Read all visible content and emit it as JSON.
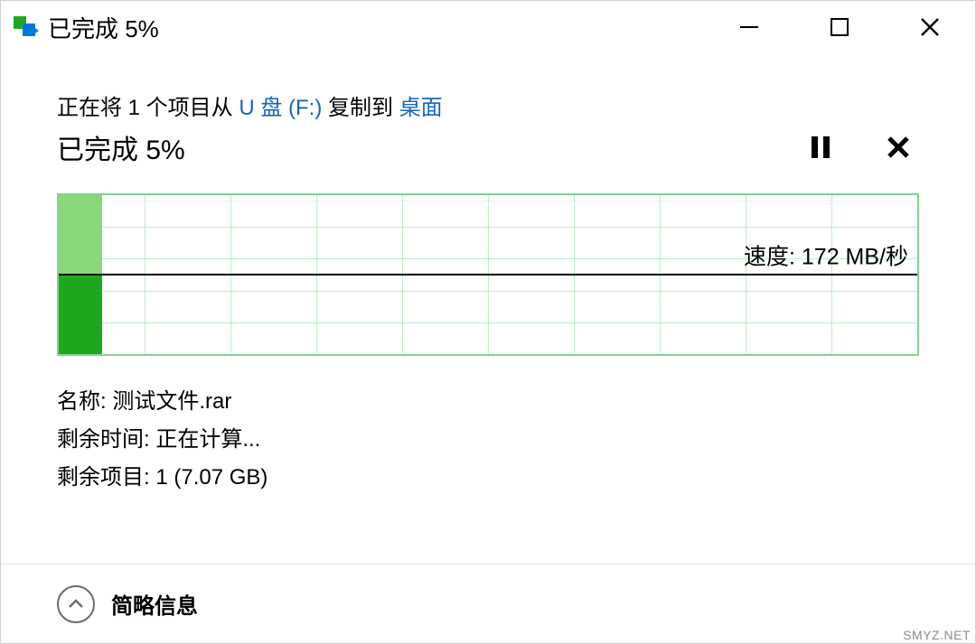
{
  "titlebar": {
    "title": "已完成 5%"
  },
  "copy": {
    "prefix": "正在将 1 个项目从 ",
    "source": "U 盘 (F:)",
    "middle": " 复制到 ",
    "dest": "桌面"
  },
  "progress": {
    "label": "已完成 5%"
  },
  "chart_data": {
    "type": "bar",
    "progress_percent": 5,
    "speed_label": "速度: 172 MB/秒",
    "grid_cols": 10,
    "grid_rows": 5
  },
  "details": {
    "name_label": "名称: ",
    "name_value": "测试文件.rar",
    "time_label": "剩余时间: ",
    "time_value": "正在计算...",
    "items_label": "剩余项目: ",
    "items_value": "1 (7.07 GB)"
  },
  "footer": {
    "brief_label": "简略信息"
  },
  "watermark": "SMYZ.NET"
}
